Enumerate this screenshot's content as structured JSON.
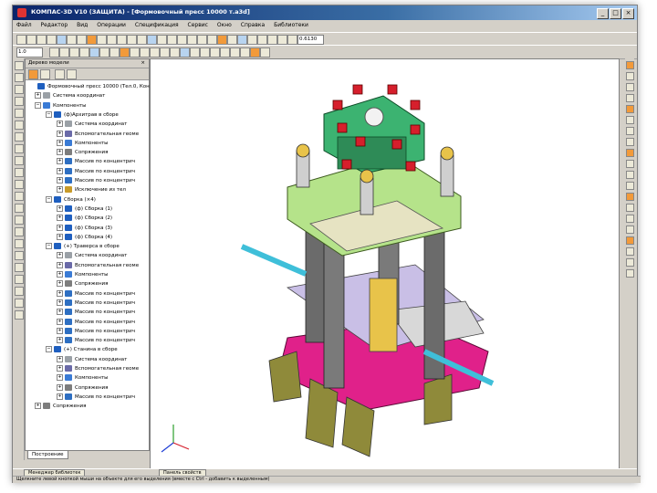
{
  "window": {
    "title": "КОМПАС-3D V10 (ЗАЩИТА) - [Формовочный пресс 10000 т.a3d]",
    "buttons": [
      "_",
      "□",
      "×"
    ]
  },
  "menu": [
    "Файл",
    "Редактор",
    "Вид",
    "Операции",
    "Спецификация",
    "Сервис",
    "Окно",
    "Справка",
    "Библиотеки"
  ],
  "toolbar": {
    "zoom_value": "0.6130",
    "scale_value": "1.0"
  },
  "tree_panel": {
    "title": "Дерево модели",
    "close": "×",
    "items": [
      {
        "label": "Формовочный пресс 10000 (Тел.0, Кон",
        "exp": "",
        "icon": "assembly"
      },
      {
        "label": "Система координат",
        "exp": "+",
        "icon": "coord"
      },
      {
        "label": "Компоненты",
        "exp": "−",
        "icon": "components"
      },
      {
        "label": "(ф)Архитрав в сборе",
        "exp": "−",
        "icon": "assembly"
      },
      {
        "label": "Система координат",
        "exp": "+",
        "icon": "coord"
      },
      {
        "label": "Вспомогательная геоме",
        "exp": "+",
        "icon": "geom"
      },
      {
        "label": "Компоненты",
        "exp": "+",
        "icon": "components"
      },
      {
        "label": "Сопряжения",
        "exp": "+",
        "icon": "mate"
      },
      {
        "label": "Массив по концентрич",
        "exp": "+",
        "icon": "array"
      },
      {
        "label": "Массив по концентрич",
        "exp": "+",
        "icon": "array"
      },
      {
        "label": "Массив по концентрич",
        "exp": "+",
        "icon": "array"
      },
      {
        "label": "Исключение из тел",
        "exp": "+",
        "icon": "excl"
      },
      {
        "label": "Сборка (×4)",
        "exp": "−",
        "icon": "assembly"
      },
      {
        "label": "(ф) Сборка (1)",
        "exp": "+",
        "icon": "assembly"
      },
      {
        "label": "(ф) Сборка (2)",
        "exp": "+",
        "icon": "assembly"
      },
      {
        "label": "(ф) Сборка (3)",
        "exp": "+",
        "icon": "assembly"
      },
      {
        "label": "(ф) Сборка (4)",
        "exp": "+",
        "icon": "assembly"
      },
      {
        "label": "(+) Траверса в сборе",
        "exp": "−",
        "icon": "assembly"
      },
      {
        "label": "Система координат",
        "exp": "+",
        "icon": "coord"
      },
      {
        "label": "Вспомогательная геоме",
        "exp": "+",
        "icon": "geom"
      },
      {
        "label": "Компоненты",
        "exp": "+",
        "icon": "components"
      },
      {
        "label": "Сопряжения",
        "exp": "+",
        "icon": "mate"
      },
      {
        "label": "Массив по концентрич",
        "exp": "+",
        "icon": "array"
      },
      {
        "label": "Массив по концентрич",
        "exp": "+",
        "icon": "array"
      },
      {
        "label": "Массив по концентрич",
        "exp": "+",
        "icon": "array"
      },
      {
        "label": "Массив по концентрич",
        "exp": "+",
        "icon": "array"
      },
      {
        "label": "Массив по концентрич",
        "exp": "+",
        "icon": "array"
      },
      {
        "label": "Массив по концентрич",
        "exp": "+",
        "icon": "array"
      },
      {
        "label": "(+) Станина в сборе",
        "exp": "−",
        "icon": "assembly"
      },
      {
        "label": "Система координат",
        "exp": "+",
        "icon": "coord"
      },
      {
        "label": "Вспомогательная геоме",
        "exp": "+",
        "icon": "geom"
      },
      {
        "label": "Компоненты",
        "exp": "+",
        "icon": "components"
      },
      {
        "label": "Сопряжения",
        "exp": "+",
        "icon": "mate"
      },
      {
        "label": "Массив по концентрич",
        "exp": "+",
        "icon": "array"
      },
      {
        "label": "Сопряжения",
        "exp": "+",
        "icon": "mate"
      }
    ]
  },
  "tree_tab": "Построение",
  "taskbar": [
    "Менеджер библиотек",
    "Панель свойств"
  ],
  "status": "Щелкните левой кнопкой мыши на объекте для его выделения (вместе с Ctrl - добавить к выделенным)",
  "colors": {
    "titlebar": "#0a246a",
    "frame": "#d4d0c8",
    "top_plate": "#3cb371",
    "crossbar": "#b5e38a",
    "base": "#e0218a",
    "columns": "#6b6b6b",
    "slide": "#c9bfe6",
    "accent_orange": "#f29a3a"
  }
}
